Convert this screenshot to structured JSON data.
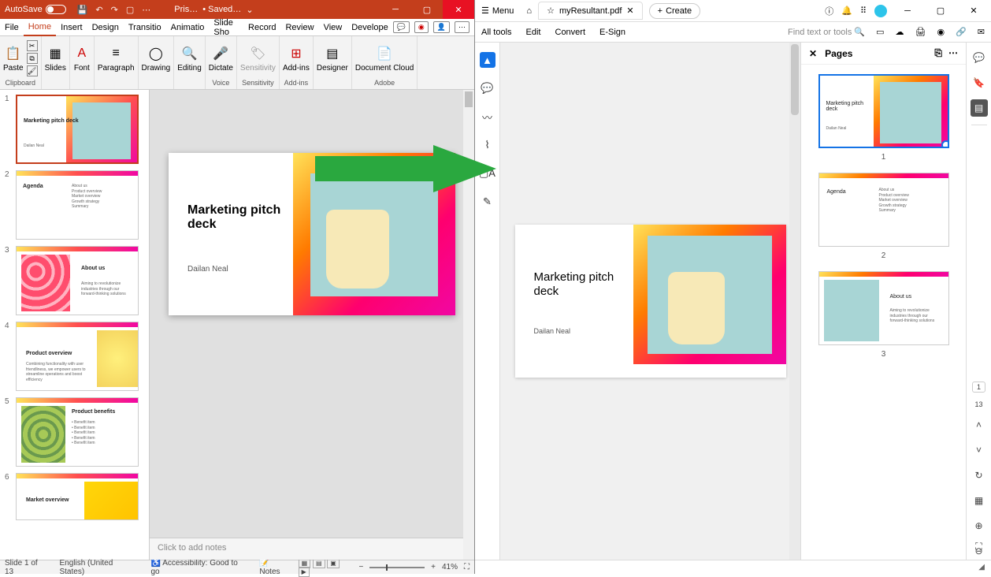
{
  "powerpoint": {
    "titlebar": {
      "autosave_label": "AutoSave",
      "doc_name": "Pris…",
      "saved_label": "• Saved…"
    },
    "tabs": [
      "File",
      "Home",
      "Insert",
      "Design",
      "Transitio",
      "Animatio",
      "Slide Sho",
      "Record",
      "Review",
      "View",
      "Develope"
    ],
    "active_tab": "Home",
    "ribbon": {
      "clipboard": {
        "paste": "Paste",
        "label": "Clipboard"
      },
      "slides": {
        "label": "Slides",
        "btn": "Slides"
      },
      "font": {
        "label": "Font",
        "btn": "Font"
      },
      "paragraph": {
        "label": "Paragraph",
        "btn": "Paragraph"
      },
      "drawing": {
        "label": "Drawing",
        "btn": "Drawing"
      },
      "editing": {
        "label": "Editing",
        "btn": "Editing"
      },
      "dictate": {
        "label": "Voice",
        "btn": "Dictate"
      },
      "sensitivity": {
        "label": "Sensitivity",
        "btn": "Sensitivity"
      },
      "addins": {
        "label": "Add-ins",
        "btn": "Add-ins"
      },
      "designer": {
        "btn": "Designer"
      },
      "adobe": {
        "btn": "Document Cloud",
        "label": "Adobe"
      }
    },
    "slides": [
      {
        "num": "1",
        "title": "Marketing pitch deck",
        "author": "Dailan Neal"
      },
      {
        "num": "2",
        "title": "Agenda",
        "items": "About us\nProduct overview\nMarket overview\nGrowth strategy\nSummary"
      },
      {
        "num": "3",
        "title": "About us",
        "items": "Aiming to revolutionize industries through our forward-thinking solutions"
      },
      {
        "num": "4",
        "title": "Product overview",
        "items": "Combining functionality with user friendliness, we empower users to streamline operations and boost efficiency"
      },
      {
        "num": "5",
        "title": "Product benefits",
        "items": "• Benefit item\n• Benefit item\n• Benefit item\n• Benefit item\n• Benefit item"
      },
      {
        "num": "6",
        "title": "Market overview"
      }
    ],
    "main_slide": {
      "title": "Marketing pitch deck",
      "author": "Dailan Neal"
    },
    "notes_placeholder": "Click to add notes",
    "status": {
      "slide": "Slide 1 of 13",
      "lang": "English (United States)",
      "accessibility": "Accessibility: Good to go",
      "notes": "Notes",
      "zoom": "41%"
    }
  },
  "acrobat": {
    "titlebar": {
      "menu": "Menu",
      "filename": "myResultant.pdf",
      "create": "Create"
    },
    "toolbar": {
      "all_tools": "All tools",
      "edit": "Edit",
      "convert": "Convert",
      "esign": "E-Sign",
      "search": "Find text or tools"
    },
    "pages_panel": {
      "title": "Pages"
    },
    "pdf_slide": {
      "title": "Marketing pitch deck",
      "author": "Dailan Neal"
    },
    "page_thumbs": [
      {
        "num": "1",
        "title": "Marketing pitch deck",
        "author": "Dailan Neal"
      },
      {
        "num": "2",
        "title": "Agenda",
        "items": "About us\nProduct overview\nMarket overview\nGrowth strategy\nSummary"
      },
      {
        "num": "3",
        "title": "About us",
        "items": "Aiming to revolutionize industries through our forward-thinking solutions"
      }
    ],
    "page_indicator": "1",
    "total_pages": "13"
  }
}
